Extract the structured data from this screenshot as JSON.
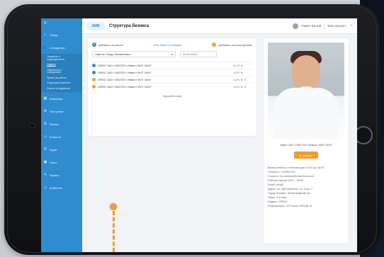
{
  "sidebar": {
    "items": [
      {
        "label": "Обзор",
        "icon": "home-icon"
      },
      {
        "label": "Сотрудники",
        "icon": "users-icon"
      },
      {
        "label": "Компании",
        "icon": "building-icon"
      },
      {
        "label": "Настройки",
        "icon": "gear-icon"
      },
      {
        "label": "Заказы",
        "icon": "list-icon"
      },
      {
        "label": "Клиенты",
        "icon": "user-icon"
      },
      {
        "label": "Аудит",
        "icon": "shield-icon"
      },
      {
        "label": "Офис",
        "icon": "office-icon"
      },
      {
        "label": "Задачи",
        "icon": "clipboard-icon"
      },
      {
        "label": "Шаблоны",
        "icon": "template-icon"
      }
    ],
    "subitems": [
      "Сведения о подразделении",
      "Отделы",
      "Обязанности сотрудников",
      "Прием на работу",
      "Структура компании",
      "Список сотрудников"
    ]
  },
  "header": {
    "logo": "SMB",
    "title": "Структура бизнеса",
    "user": "Павел Белый",
    "user_role": "Ваш аккаунт"
  },
  "content": {
    "add_label": "Добавить в список",
    "link_label": "ОЗК Закон и Порядок",
    "add_personal_label": "Добавить личные данные",
    "selected": "Павлов Тимур Михайлович",
    "date": "23.10.2019",
    "list": [
      {
        "name": "ОФИС ЗАО «ЭКСПО» Инвест ФИТ 34/67",
        "ind": "Ш.Я. В.",
        "bullet": "blue"
      },
      {
        "name": "ОФИС ЗАО «ЭКСПО» Инвест ФИТ 34/67",
        "ind": "Ш.Я. В.",
        "bullet": "blue"
      },
      {
        "name": "ОФИС ЗАО «ЭКСПО» Инвест ФИТ 34/67",
        "ind": "Ш.Я. В. Е.",
        "bullet": "orange"
      },
      {
        "name": "ОФИС ЗАО «ЭКСПО» Инвест ФИТ 34/67",
        "ind": "Ш.Я. В. Е.",
        "bullet": "orange"
      }
    ],
    "load_more": "Загрузить ещё"
  },
  "profile": {
    "caption": "Офис ЗАО «ЭКСПО» Инвест ФИТ 34/67",
    "button": "В процесс",
    "lines": [
      "Время работы: в течении дня с 8:00 до 18:00",
      "Телефон: +7(999) 422",
      "Соцсети: vk.com/profile.facebook.com",
      "Рабочее время: 8:00 – 18:00",
      "Email: info@",
      "Адрес: ул. Центральная, 12, корп. 2",
      "Город: Москва, Ленинградский пр.",
      "Офис: 2-й этаж",
      "Индекс: 125040",
      "Информация: 125 тысяч ОКВЭД 14"
    ]
  }
}
